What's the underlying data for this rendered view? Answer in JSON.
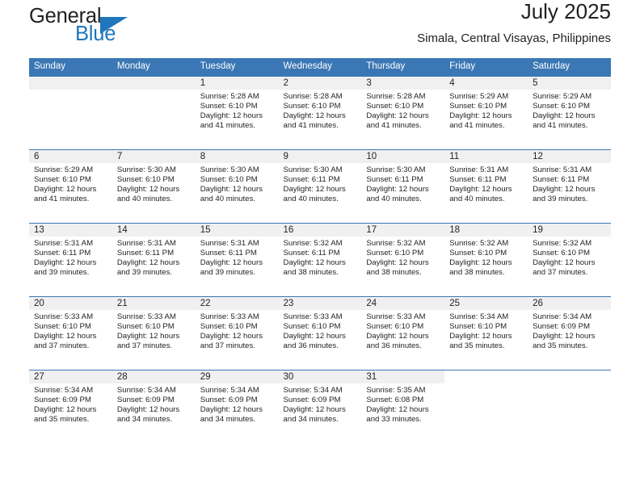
{
  "brand": {
    "name_part1": "General",
    "name_part2": "Blue",
    "accent_color": "#1f76bc"
  },
  "header": {
    "title": "July 2025",
    "location": "Simala, Central Visayas, Philippines"
  },
  "theme": {
    "header_row_color": "#3b77b5",
    "daynum_band_color": "#f0f0f0",
    "text_color": "#231f20"
  },
  "weekday_headers": [
    "Sunday",
    "Monday",
    "Tuesday",
    "Wednesday",
    "Thursday",
    "Friday",
    "Saturday"
  ],
  "labels": {
    "sunrise_prefix": "Sunrise:",
    "sunset_prefix": "Sunset:",
    "daylight_prefix": "Daylight:"
  },
  "weeks": [
    [
      {
        "day": "",
        "empty": true
      },
      {
        "day": "",
        "empty": true
      },
      {
        "day": "1",
        "sunrise": "Sunrise: 5:28 AM",
        "sunset": "Sunset: 6:10 PM",
        "daylight_l1": "Daylight: 12 hours",
        "daylight_l2": "and 41 minutes."
      },
      {
        "day": "2",
        "sunrise": "Sunrise: 5:28 AM",
        "sunset": "Sunset: 6:10 PM",
        "daylight_l1": "Daylight: 12 hours",
        "daylight_l2": "and 41 minutes."
      },
      {
        "day": "3",
        "sunrise": "Sunrise: 5:28 AM",
        "sunset": "Sunset: 6:10 PM",
        "daylight_l1": "Daylight: 12 hours",
        "daylight_l2": "and 41 minutes."
      },
      {
        "day": "4",
        "sunrise": "Sunrise: 5:29 AM",
        "sunset": "Sunset: 6:10 PM",
        "daylight_l1": "Daylight: 12 hours",
        "daylight_l2": "and 41 minutes."
      },
      {
        "day": "5",
        "sunrise": "Sunrise: 5:29 AM",
        "sunset": "Sunset: 6:10 PM",
        "daylight_l1": "Daylight: 12 hours",
        "daylight_l2": "and 41 minutes."
      }
    ],
    [
      {
        "day": "6",
        "sunrise": "Sunrise: 5:29 AM",
        "sunset": "Sunset: 6:10 PM",
        "daylight_l1": "Daylight: 12 hours",
        "daylight_l2": "and 41 minutes."
      },
      {
        "day": "7",
        "sunrise": "Sunrise: 5:30 AM",
        "sunset": "Sunset: 6:10 PM",
        "daylight_l1": "Daylight: 12 hours",
        "daylight_l2": "and 40 minutes."
      },
      {
        "day": "8",
        "sunrise": "Sunrise: 5:30 AM",
        "sunset": "Sunset: 6:10 PM",
        "daylight_l1": "Daylight: 12 hours",
        "daylight_l2": "and 40 minutes."
      },
      {
        "day": "9",
        "sunrise": "Sunrise: 5:30 AM",
        "sunset": "Sunset: 6:11 PM",
        "daylight_l1": "Daylight: 12 hours",
        "daylight_l2": "and 40 minutes."
      },
      {
        "day": "10",
        "sunrise": "Sunrise: 5:30 AM",
        "sunset": "Sunset: 6:11 PM",
        "daylight_l1": "Daylight: 12 hours",
        "daylight_l2": "and 40 minutes."
      },
      {
        "day": "11",
        "sunrise": "Sunrise: 5:31 AM",
        "sunset": "Sunset: 6:11 PM",
        "daylight_l1": "Daylight: 12 hours",
        "daylight_l2": "and 40 minutes."
      },
      {
        "day": "12",
        "sunrise": "Sunrise: 5:31 AM",
        "sunset": "Sunset: 6:11 PM",
        "daylight_l1": "Daylight: 12 hours",
        "daylight_l2": "and 39 minutes."
      }
    ],
    [
      {
        "day": "13",
        "sunrise": "Sunrise: 5:31 AM",
        "sunset": "Sunset: 6:11 PM",
        "daylight_l1": "Daylight: 12 hours",
        "daylight_l2": "and 39 minutes."
      },
      {
        "day": "14",
        "sunrise": "Sunrise: 5:31 AM",
        "sunset": "Sunset: 6:11 PM",
        "daylight_l1": "Daylight: 12 hours",
        "daylight_l2": "and 39 minutes."
      },
      {
        "day": "15",
        "sunrise": "Sunrise: 5:31 AM",
        "sunset": "Sunset: 6:11 PM",
        "daylight_l1": "Daylight: 12 hours",
        "daylight_l2": "and 39 minutes."
      },
      {
        "day": "16",
        "sunrise": "Sunrise: 5:32 AM",
        "sunset": "Sunset: 6:11 PM",
        "daylight_l1": "Daylight: 12 hours",
        "daylight_l2": "and 38 minutes."
      },
      {
        "day": "17",
        "sunrise": "Sunrise: 5:32 AM",
        "sunset": "Sunset: 6:10 PM",
        "daylight_l1": "Daylight: 12 hours",
        "daylight_l2": "and 38 minutes."
      },
      {
        "day": "18",
        "sunrise": "Sunrise: 5:32 AM",
        "sunset": "Sunset: 6:10 PM",
        "daylight_l1": "Daylight: 12 hours",
        "daylight_l2": "and 38 minutes."
      },
      {
        "day": "19",
        "sunrise": "Sunrise: 5:32 AM",
        "sunset": "Sunset: 6:10 PM",
        "daylight_l1": "Daylight: 12 hours",
        "daylight_l2": "and 37 minutes."
      }
    ],
    [
      {
        "day": "20",
        "sunrise": "Sunrise: 5:33 AM",
        "sunset": "Sunset: 6:10 PM",
        "daylight_l1": "Daylight: 12 hours",
        "daylight_l2": "and 37 minutes."
      },
      {
        "day": "21",
        "sunrise": "Sunrise: 5:33 AM",
        "sunset": "Sunset: 6:10 PM",
        "daylight_l1": "Daylight: 12 hours",
        "daylight_l2": "and 37 minutes."
      },
      {
        "day": "22",
        "sunrise": "Sunrise: 5:33 AM",
        "sunset": "Sunset: 6:10 PM",
        "daylight_l1": "Daylight: 12 hours",
        "daylight_l2": "and 37 minutes."
      },
      {
        "day": "23",
        "sunrise": "Sunrise: 5:33 AM",
        "sunset": "Sunset: 6:10 PM",
        "daylight_l1": "Daylight: 12 hours",
        "daylight_l2": "and 36 minutes."
      },
      {
        "day": "24",
        "sunrise": "Sunrise: 5:33 AM",
        "sunset": "Sunset: 6:10 PM",
        "daylight_l1": "Daylight: 12 hours",
        "daylight_l2": "and 36 minutes."
      },
      {
        "day": "25",
        "sunrise": "Sunrise: 5:34 AM",
        "sunset": "Sunset: 6:10 PM",
        "daylight_l1": "Daylight: 12 hours",
        "daylight_l2": "and 35 minutes."
      },
      {
        "day": "26",
        "sunrise": "Sunrise: 5:34 AM",
        "sunset": "Sunset: 6:09 PM",
        "daylight_l1": "Daylight: 12 hours",
        "daylight_l2": "and 35 minutes."
      }
    ],
    [
      {
        "day": "27",
        "sunrise": "Sunrise: 5:34 AM",
        "sunset": "Sunset: 6:09 PM",
        "daylight_l1": "Daylight: 12 hours",
        "daylight_l2": "and 35 minutes."
      },
      {
        "day": "28",
        "sunrise": "Sunrise: 5:34 AM",
        "sunset": "Sunset: 6:09 PM",
        "daylight_l1": "Daylight: 12 hours",
        "daylight_l2": "and 34 minutes."
      },
      {
        "day": "29",
        "sunrise": "Sunrise: 5:34 AM",
        "sunset": "Sunset: 6:09 PM",
        "daylight_l1": "Daylight: 12 hours",
        "daylight_l2": "and 34 minutes."
      },
      {
        "day": "30",
        "sunrise": "Sunrise: 5:34 AM",
        "sunset": "Sunset: 6:09 PM",
        "daylight_l1": "Daylight: 12 hours",
        "daylight_l2": "and 34 minutes."
      },
      {
        "day": "31",
        "sunrise": "Sunrise: 5:35 AM",
        "sunset": "Sunset: 6:08 PM",
        "daylight_l1": "Daylight: 12 hours",
        "daylight_l2": "and 33 minutes."
      },
      {
        "day": "",
        "blank": true
      },
      {
        "day": "",
        "blank": true
      }
    ]
  ]
}
